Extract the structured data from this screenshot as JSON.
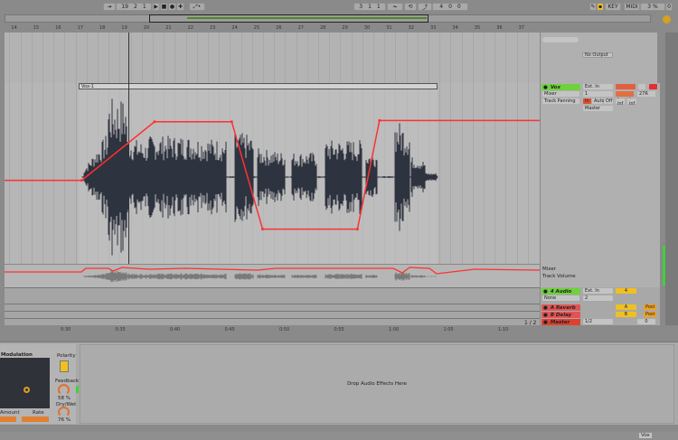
{
  "transport": {
    "position": [
      "19",
      "2",
      "1"
    ],
    "loop_start": [
      "3",
      "1",
      "1"
    ],
    "loop_length": [
      "4",
      "0",
      "0"
    ],
    "key_label": "KEY",
    "midi_label": "MIDI",
    "cpu": "3 %",
    "disk": "0"
  },
  "ruler": {
    "bars": [
      "14",
      "15",
      "16",
      "17",
      "18",
      "19",
      "20",
      "21",
      "22",
      "23",
      "24",
      "25",
      "26",
      "27",
      "28",
      "29",
      "30",
      "31",
      "32",
      "33",
      "34",
      "35",
      "36",
      "37"
    ]
  },
  "time_ruler": [
    "0:30",
    "0:35",
    "0:40",
    "0:45",
    "0:50",
    "0:55",
    "1:00",
    "1:05",
    "1:10"
  ],
  "tracks": {
    "top": {
      "output": "No Output"
    },
    "vox": {
      "name": "Vox",
      "clip": "Vox-1",
      "input": "Ext. In",
      "input_channel": "1",
      "device_chooser": "Mixer",
      "parameter_chooser": "Track Panning",
      "monitor": [
        "In",
        "Auto",
        "Off"
      ],
      "output": "Master",
      "pan": "27R",
      "sends": [
        "-inf",
        "-inf"
      ],
      "lane_device": "Mixer",
      "lane_param": "Track Volume"
    },
    "audio4": {
      "name": "4 Audio",
      "input": "Ext. In",
      "chooser": "None",
      "input_channel": "2",
      "number": "4"
    },
    "returns": [
      {
        "name": "A Reverb",
        "letter": "A",
        "post": "Post"
      },
      {
        "name": "B Delay",
        "letter": "B",
        "post": "Post"
      }
    ],
    "master": {
      "name": "Master",
      "output": "1/2",
      "volume": "0"
    }
  },
  "page_indicator": "1 / 2",
  "device": {
    "title": "Modulation",
    "polarity": "Polarity",
    "feedback": "Feedback",
    "feedback_value": "58 %",
    "drywet": "Dry/Wet",
    "drywet_value": "76 %",
    "amount": "Amount",
    "rate": "Rate",
    "drop_hint": "Drop Audio Effects Here"
  },
  "status": {
    "track": "Vox"
  },
  "colors": {
    "accent": "#f0c020",
    "automation": "#ff3030",
    "track_green": "#6ed23c",
    "return_red": "#e25454"
  },
  "automation_points": [
    [
      0,
      -0.05
    ],
    [
      3.5,
      -0.05
    ],
    [
      6.8,
      0.85
    ],
    [
      10.3,
      0.85
    ],
    [
      11.7,
      -0.8
    ],
    [
      16,
      -0.8
    ],
    [
      17,
      0.87
    ],
    [
      24.5,
      0.87
    ]
  ]
}
